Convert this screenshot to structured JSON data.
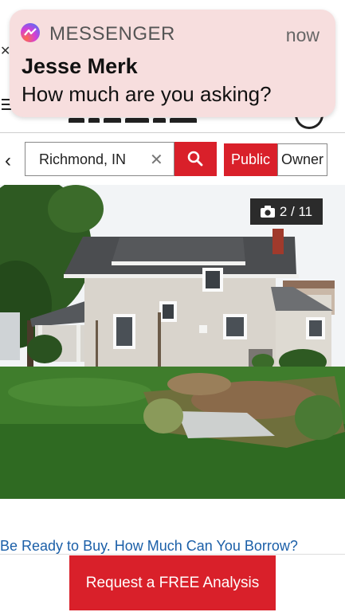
{
  "notification": {
    "app_name": "MESSENGER",
    "time": "now",
    "sender": "Jesse Merk",
    "message": "How much are you asking?",
    "icon": "messenger-icon"
  },
  "search": {
    "value": "Richmond, IN",
    "clear_icon": "close-icon",
    "button_icon": "search-icon"
  },
  "filter_toggle": {
    "public_label": "Public",
    "owner_label": "Owner",
    "selected": "Public"
  },
  "photo": {
    "counter": "2 / 11",
    "counter_icon": "camera-icon"
  },
  "ad": {
    "link_text": "Be Ready to Buy. How Much Can You Borrow?",
    "cta_label": "Request a FREE Analysis"
  },
  "colors": {
    "accent": "#d9202a",
    "link": "#1b5fa8",
    "notification_bg": "#f7dede"
  }
}
